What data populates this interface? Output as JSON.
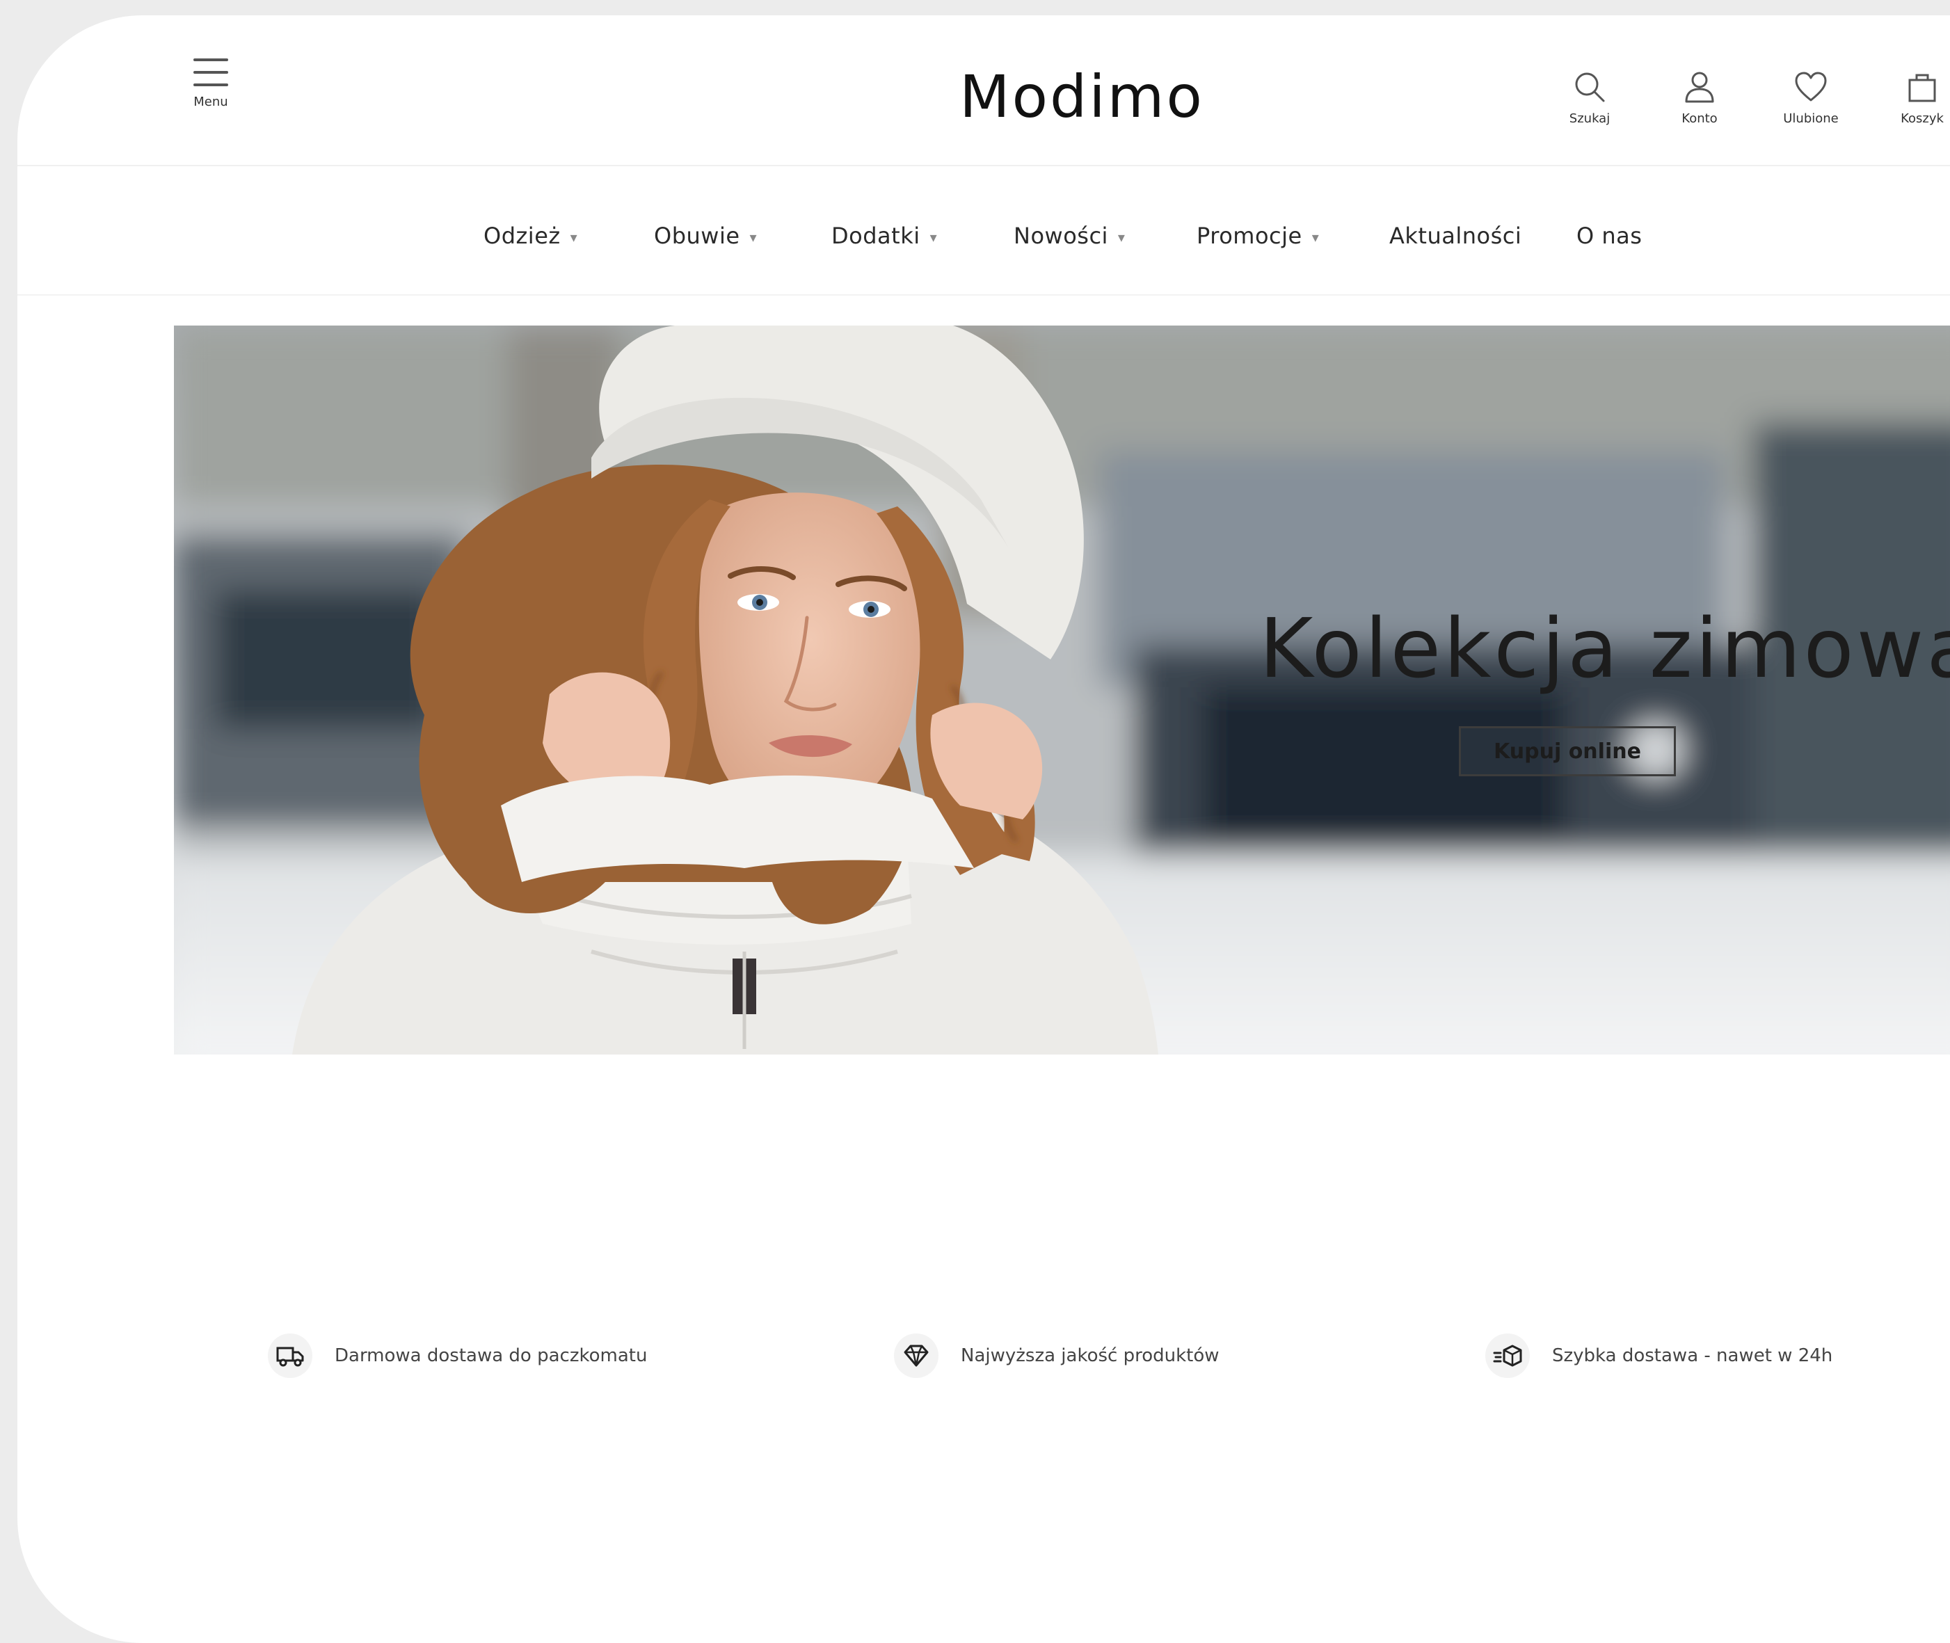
{
  "header": {
    "menu_label": "Menu",
    "logo": "Modimo",
    "icons": [
      {
        "name": "search-icon",
        "label": "Szukaj"
      },
      {
        "name": "user-icon",
        "label": "Konto"
      },
      {
        "name": "heart-icon",
        "label": "Ulubione"
      },
      {
        "name": "bag-icon",
        "label": "Koszyk"
      }
    ]
  },
  "nav": {
    "items": [
      {
        "label": "Odzież",
        "has_dropdown": true
      },
      {
        "label": "Obuwie",
        "has_dropdown": true
      },
      {
        "label": "Dodatki",
        "has_dropdown": true
      },
      {
        "label": "Nowości",
        "has_dropdown": true
      },
      {
        "label": "Promocje",
        "has_dropdown": true
      },
      {
        "label": "Aktualności",
        "has_dropdown": false
      },
      {
        "label": "O nas",
        "has_dropdown": false
      }
    ],
    "dropdown_glyph": "▾"
  },
  "hero": {
    "title": "Kolekcja zimowa",
    "cta_label": "Kupuj online"
  },
  "features": [
    {
      "icon": "truck-icon",
      "text": "Darmowa dostawa do paczkomatu"
    },
    {
      "icon": "diamond-icon",
      "text": "Najwyższa jakość produktów"
    },
    {
      "icon": "fast-box-icon",
      "text": "Szybka dostawa - nawet w 24h"
    }
  ],
  "colors": {
    "text": "#1a1a1a",
    "muted": "#444444",
    "border": "#f0f0f0",
    "feature_icon_bg": "#f3f3f3"
  }
}
